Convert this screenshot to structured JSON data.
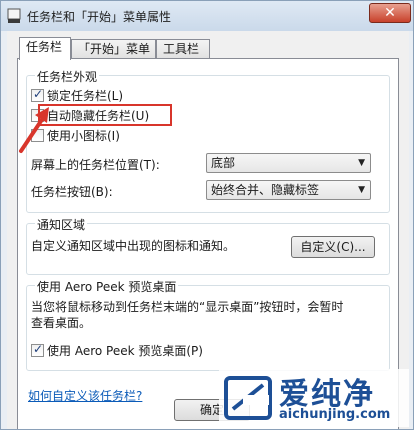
{
  "window": {
    "title": "任务栏和「开始」菜单属性",
    "close_label": "✕"
  },
  "tabs": [
    {
      "label": "任务栏",
      "active": true
    },
    {
      "label": "「开始」菜单",
      "active": false
    },
    {
      "label": "工具栏",
      "active": false
    }
  ],
  "appearance": {
    "group_title": "任务栏外观",
    "lock": {
      "label": "锁定任务栏(L)",
      "checked": true
    },
    "autohide": {
      "label": "自动隐藏任务栏(U)",
      "checked": false
    },
    "small_icons": {
      "label": "使用小图标(I)",
      "checked": false
    },
    "location_label": "屏幕上的任务栏位置(T):",
    "location_value": "底部",
    "buttons_label": "任务栏按钮(B):",
    "buttons_value": "始终合并、隐藏标签"
  },
  "notification": {
    "group_title": "通知区域",
    "description": "自定义通知区域中出现的图标和通知。",
    "customize_button": "自定义(C)..."
  },
  "aero": {
    "group_title": "使用 Aero Peek 预览桌面",
    "description_line1": "当您将鼠标移动到任务栏末端的“显示桌面”按钮时，会暂时",
    "description_line2": "查看桌面。",
    "checkbox": {
      "label": "使用 Aero Peek 预览桌面(P)",
      "checked": true
    }
  },
  "help_link": "如何自定义该任务栏?",
  "ok_button": "确定",
  "watermark": {
    "name": "爱纯净",
    "url": "aichunjing.com"
  },
  "colors": {
    "highlight": "#d8352b",
    "link": "#0b5bb8",
    "brand": "#1d4f96"
  }
}
